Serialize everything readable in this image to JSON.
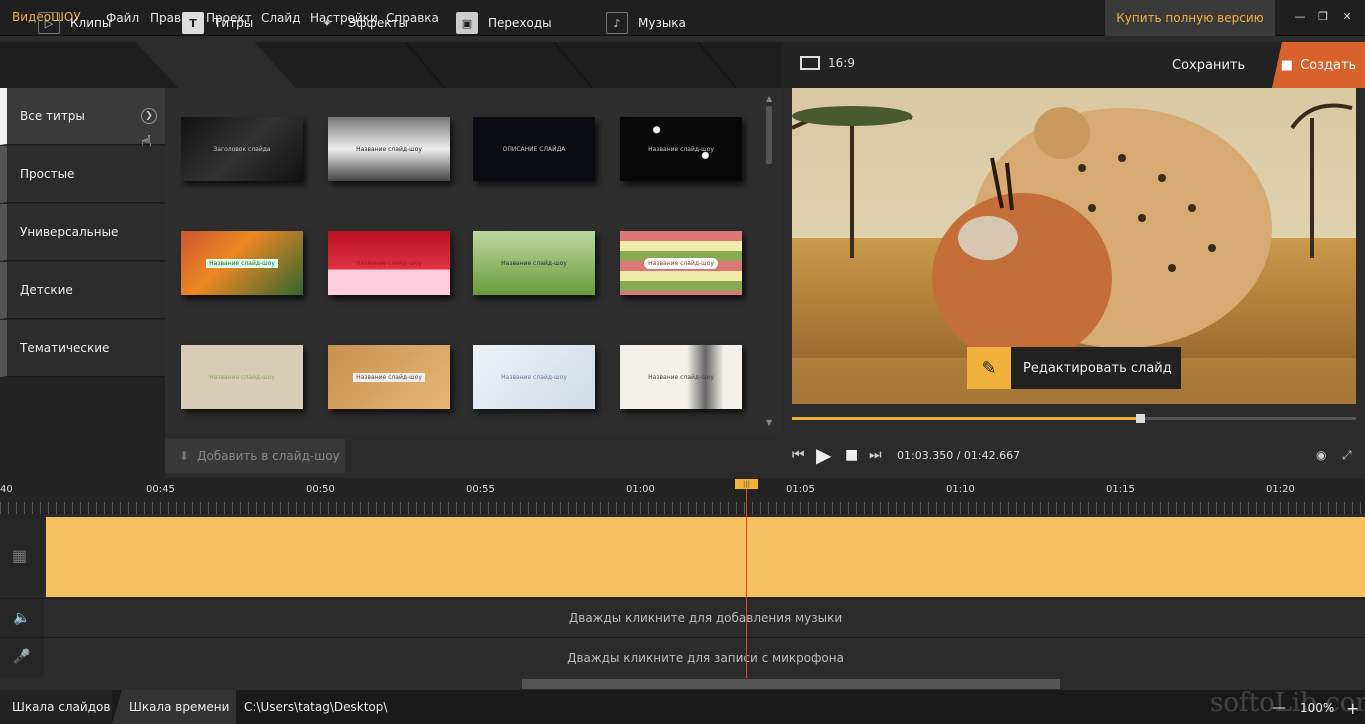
{
  "app": {
    "logo_part1": "Видео",
    "logo_part2": "ШОУ"
  },
  "menu": [
    "Файл",
    "Правка",
    "Проект",
    "Слайд",
    "Настройки",
    "Справка"
  ],
  "buy_button": "Купить полную версию",
  "tabs": [
    {
      "label": "Клипы",
      "icon": "play-icon"
    },
    {
      "label": "Титры",
      "icon": "text-icon"
    },
    {
      "label": "Эффекты",
      "icon": "magic-wand-icon"
    },
    {
      "label": "Переходы",
      "icon": "clapper-icon"
    },
    {
      "label": "Музыка",
      "icon": "music-note-icon"
    }
  ],
  "categories": [
    "Все титры",
    "Простые",
    "Универсальные",
    "Детские",
    "Тематические"
  ],
  "thumbnails": [
    "Заголовок слайда",
    "Название слайд-шоу",
    "ОПИСАНИЕ СЛАЙДА",
    "Название слайд-шоу",
    "Название слайд-шоу",
    "Название слайд-шоу",
    "Название слайд-шоу",
    "Название слайд-шоу",
    "Название слайд-шоу",
    "Название слайд-шоу",
    "Название слайд-шоу",
    "Название слайд-шоу"
  ],
  "add_button": "Добавить в слайд-шоу",
  "preview": {
    "aspect_ratio": "16:9",
    "save": "Сохранить",
    "create": "Создать",
    "edit_slide": "Редактировать слайд",
    "timecode": "01:03.350 / 01:42.667",
    "progress": 0.617
  },
  "timeline": {
    "ticks": [
      "40",
      "00:45",
      "00:50",
      "00:55",
      "01:00",
      "01:05",
      "01:10",
      "01:15",
      "01:20"
    ],
    "music_hint": "Дважды кликните для добавления музыки",
    "mic_hint": "Дважды кликните для записи с микрофона"
  },
  "bottom": {
    "tab1": "Шкала слайдов",
    "tab2": "Шкала времени",
    "path": "C:\\Users\\tatag\\Desktop\\",
    "zoom": "100%"
  },
  "watermark": "softoLib.com",
  "colors": {
    "accent": "#f0b23c",
    "create": "#d9612b",
    "playhead": "#e0452a"
  }
}
